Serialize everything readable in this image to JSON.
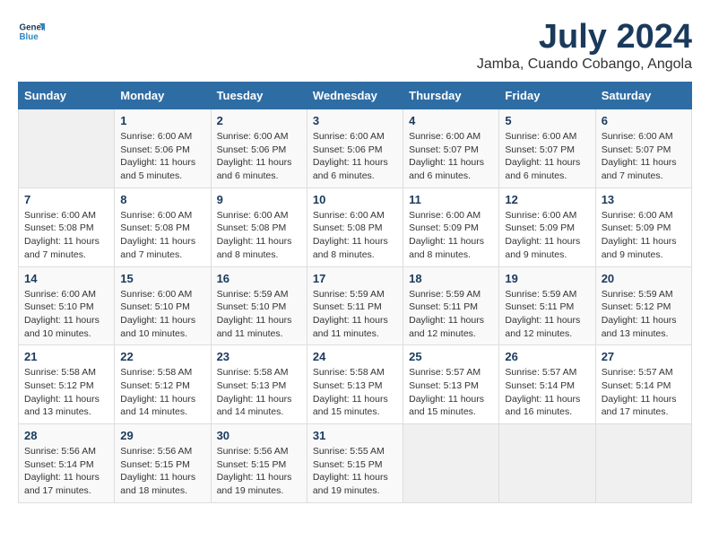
{
  "logo": {
    "line1": "General",
    "line2": "Blue"
  },
  "title": "July 2024",
  "subtitle": "Jamba, Cuando Cobango, Angola",
  "days_of_week": [
    "Sunday",
    "Monday",
    "Tuesday",
    "Wednesday",
    "Thursday",
    "Friday",
    "Saturday"
  ],
  "weeks": [
    [
      {
        "day": "",
        "info": ""
      },
      {
        "day": "1",
        "info": "Sunrise: 6:00 AM\nSunset: 5:06 PM\nDaylight: 11 hours\nand 5 minutes."
      },
      {
        "day": "2",
        "info": "Sunrise: 6:00 AM\nSunset: 5:06 PM\nDaylight: 11 hours\nand 6 minutes."
      },
      {
        "day": "3",
        "info": "Sunrise: 6:00 AM\nSunset: 5:06 PM\nDaylight: 11 hours\nand 6 minutes."
      },
      {
        "day": "4",
        "info": "Sunrise: 6:00 AM\nSunset: 5:07 PM\nDaylight: 11 hours\nand 6 minutes."
      },
      {
        "day": "5",
        "info": "Sunrise: 6:00 AM\nSunset: 5:07 PM\nDaylight: 11 hours\nand 6 minutes."
      },
      {
        "day": "6",
        "info": "Sunrise: 6:00 AM\nSunset: 5:07 PM\nDaylight: 11 hours\nand 7 minutes."
      }
    ],
    [
      {
        "day": "7",
        "info": "Sunrise: 6:00 AM\nSunset: 5:08 PM\nDaylight: 11 hours\nand 7 minutes."
      },
      {
        "day": "8",
        "info": "Sunrise: 6:00 AM\nSunset: 5:08 PM\nDaylight: 11 hours\nand 7 minutes."
      },
      {
        "day": "9",
        "info": "Sunrise: 6:00 AM\nSunset: 5:08 PM\nDaylight: 11 hours\nand 8 minutes."
      },
      {
        "day": "10",
        "info": "Sunrise: 6:00 AM\nSunset: 5:08 PM\nDaylight: 11 hours\nand 8 minutes."
      },
      {
        "day": "11",
        "info": "Sunrise: 6:00 AM\nSunset: 5:09 PM\nDaylight: 11 hours\nand 8 minutes."
      },
      {
        "day": "12",
        "info": "Sunrise: 6:00 AM\nSunset: 5:09 PM\nDaylight: 11 hours\nand 9 minutes."
      },
      {
        "day": "13",
        "info": "Sunrise: 6:00 AM\nSunset: 5:09 PM\nDaylight: 11 hours\nand 9 minutes."
      }
    ],
    [
      {
        "day": "14",
        "info": "Sunrise: 6:00 AM\nSunset: 5:10 PM\nDaylight: 11 hours\nand 10 minutes."
      },
      {
        "day": "15",
        "info": "Sunrise: 6:00 AM\nSunset: 5:10 PM\nDaylight: 11 hours\nand 10 minutes."
      },
      {
        "day": "16",
        "info": "Sunrise: 5:59 AM\nSunset: 5:10 PM\nDaylight: 11 hours\nand 11 minutes."
      },
      {
        "day": "17",
        "info": "Sunrise: 5:59 AM\nSunset: 5:11 PM\nDaylight: 11 hours\nand 11 minutes."
      },
      {
        "day": "18",
        "info": "Sunrise: 5:59 AM\nSunset: 5:11 PM\nDaylight: 11 hours\nand 12 minutes."
      },
      {
        "day": "19",
        "info": "Sunrise: 5:59 AM\nSunset: 5:11 PM\nDaylight: 11 hours\nand 12 minutes."
      },
      {
        "day": "20",
        "info": "Sunrise: 5:59 AM\nSunset: 5:12 PM\nDaylight: 11 hours\nand 13 minutes."
      }
    ],
    [
      {
        "day": "21",
        "info": "Sunrise: 5:58 AM\nSunset: 5:12 PM\nDaylight: 11 hours\nand 13 minutes."
      },
      {
        "day": "22",
        "info": "Sunrise: 5:58 AM\nSunset: 5:12 PM\nDaylight: 11 hours\nand 14 minutes."
      },
      {
        "day": "23",
        "info": "Sunrise: 5:58 AM\nSunset: 5:13 PM\nDaylight: 11 hours\nand 14 minutes."
      },
      {
        "day": "24",
        "info": "Sunrise: 5:58 AM\nSunset: 5:13 PM\nDaylight: 11 hours\nand 15 minutes."
      },
      {
        "day": "25",
        "info": "Sunrise: 5:57 AM\nSunset: 5:13 PM\nDaylight: 11 hours\nand 15 minutes."
      },
      {
        "day": "26",
        "info": "Sunrise: 5:57 AM\nSunset: 5:14 PM\nDaylight: 11 hours\nand 16 minutes."
      },
      {
        "day": "27",
        "info": "Sunrise: 5:57 AM\nSunset: 5:14 PM\nDaylight: 11 hours\nand 17 minutes."
      }
    ],
    [
      {
        "day": "28",
        "info": "Sunrise: 5:56 AM\nSunset: 5:14 PM\nDaylight: 11 hours\nand 17 minutes."
      },
      {
        "day": "29",
        "info": "Sunrise: 5:56 AM\nSunset: 5:15 PM\nDaylight: 11 hours\nand 18 minutes."
      },
      {
        "day": "30",
        "info": "Sunrise: 5:56 AM\nSunset: 5:15 PM\nDaylight: 11 hours\nand 19 minutes."
      },
      {
        "day": "31",
        "info": "Sunrise: 5:55 AM\nSunset: 5:15 PM\nDaylight: 11 hours\nand 19 minutes."
      },
      {
        "day": "",
        "info": ""
      },
      {
        "day": "",
        "info": ""
      },
      {
        "day": "",
        "info": ""
      }
    ]
  ]
}
